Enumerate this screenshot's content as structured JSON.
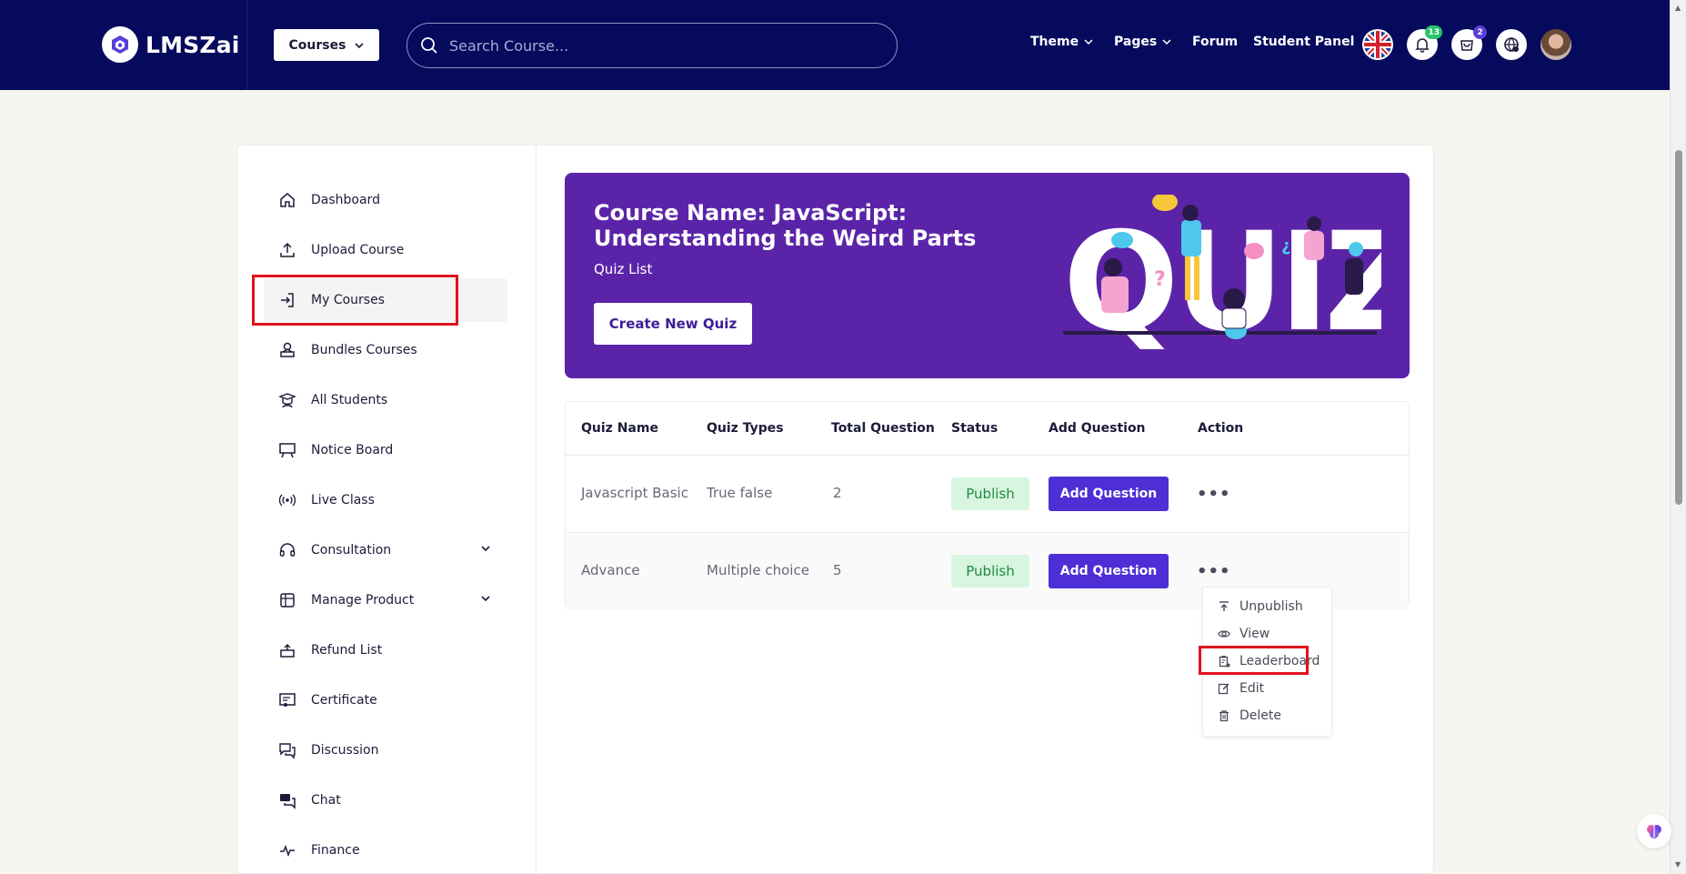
{
  "navbar": {
    "brand": "LMSZai",
    "courses_button": "Courses",
    "search_placeholder": "Search Course...",
    "links": {
      "theme": "Theme",
      "pages": "Pages",
      "forum": "Forum",
      "student_panel": "Student Panel"
    },
    "notification_count": "13",
    "cart_count": "2"
  },
  "sidebar": {
    "items": [
      {
        "label": "Dashboard",
        "icon": "home-icon"
      },
      {
        "label": "Upload Course",
        "icon": "upload-icon"
      },
      {
        "label": "My Courses",
        "icon": "login-icon"
      },
      {
        "label": "Bundles Courses",
        "icon": "bundle-icon"
      },
      {
        "label": "All Students",
        "icon": "students-icon"
      },
      {
        "label": "Notice Board",
        "icon": "board-icon"
      },
      {
        "label": "Live Class",
        "icon": "broadcast-icon"
      },
      {
        "label": "Consultation",
        "icon": "headset-icon"
      },
      {
        "label": "Manage Product",
        "icon": "product-icon"
      },
      {
        "label": "Refund List",
        "icon": "refund-icon"
      },
      {
        "label": "Certificate",
        "icon": "certificate-icon"
      },
      {
        "label": "Discussion",
        "icon": "discussion-icon"
      },
      {
        "label": "Chat",
        "icon": "chat-icon"
      },
      {
        "label": "Finance",
        "icon": "pulse-icon"
      }
    ]
  },
  "banner": {
    "title": "Course Name: JavaScript: Understanding the Weird Parts",
    "subtitle": "Quiz List",
    "create_button": "Create New Quiz"
  },
  "table": {
    "headers": [
      "Quiz Name",
      "Quiz Types",
      "Total Question",
      "Status",
      "Add Question",
      "Action"
    ],
    "rows": [
      {
        "name": "Javascript Basic",
        "type": "True false",
        "total": "2",
        "status": "Publish",
        "add": "Add Question",
        "action": "•••"
      },
      {
        "name": "Advance",
        "type": "Multiple choice",
        "total": "5",
        "status": "Publish",
        "add": "Add Question",
        "action": "•••"
      }
    ]
  },
  "dropdown": {
    "items": [
      "Unpublish",
      "View",
      "Leaderboard",
      "Edit",
      "Delete"
    ]
  },
  "colors": {
    "navbar": "#060a5c",
    "banner": "#5b24a8",
    "primary_button": "#4e2fd6",
    "publish_bg": "#d8f5e0",
    "highlight": "#e0141c"
  }
}
